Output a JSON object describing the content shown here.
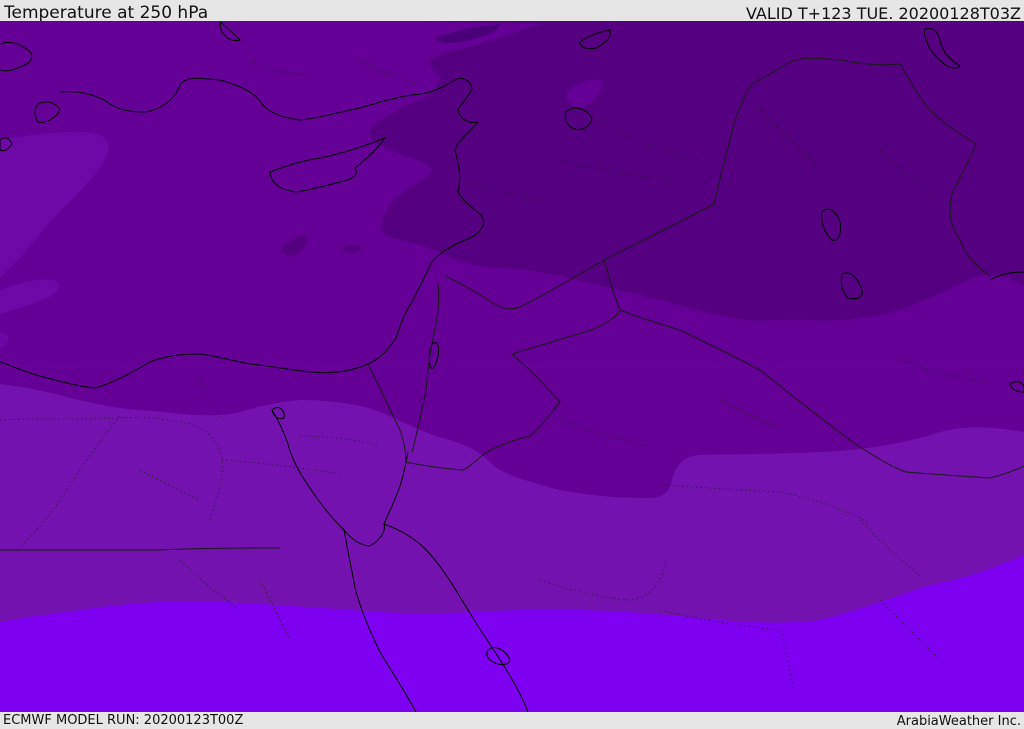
{
  "header": {
    "title": "Temperature at 250 hPa",
    "valid": "VALID T+123 TUE. 20200128T03Z"
  },
  "footer": {
    "model_run": "ECMWF MODEL RUN: 20200123T00Z",
    "credit": "ArabiaWeather Inc."
  },
  "map": {
    "region": "Eastern Mediterranean and Middle East",
    "field": "temperature",
    "level": "250 hPa",
    "colors": {
      "band_coldest": "#540080",
      "band_cold": "#640096",
      "band_mid": "#7412b0",
      "band_warm": "#7d00f0",
      "coastline": "#000000",
      "border": "#1a1a1a"
    }
  }
}
